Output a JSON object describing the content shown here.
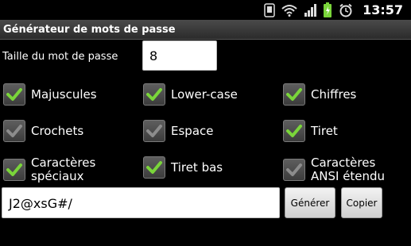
{
  "status_bar": {
    "time": "13:57",
    "icons": [
      "phone-icon",
      "wifi-icon",
      "signal-icon",
      "battery-icon",
      "alarm-icon"
    ]
  },
  "app": {
    "title": "Générateur de mots de passe"
  },
  "length": {
    "label": "Taille du mot de passe",
    "value": "8"
  },
  "options": [
    {
      "label": "Majuscules",
      "checked": true
    },
    {
      "label": "Lower-case",
      "checked": true
    },
    {
      "label": "Chiffres",
      "checked": true
    },
    {
      "label": "Crochets",
      "checked": false
    },
    {
      "label": "Espace",
      "checked": false
    },
    {
      "label": "Tiret",
      "checked": true
    },
    {
      "label": "Caractères spéciaux",
      "checked": true
    },
    {
      "label": "Tiret bas",
      "checked": true
    },
    {
      "label": "Caractères ANSI étendu",
      "checked": false
    }
  ],
  "password": {
    "value": "J2@xsG#/"
  },
  "buttons": {
    "generate": "Générer",
    "copy": "Copier"
  },
  "colors": {
    "check_on": "#7ad53a",
    "check_off": "#8c8c8c",
    "background": "#000000"
  }
}
